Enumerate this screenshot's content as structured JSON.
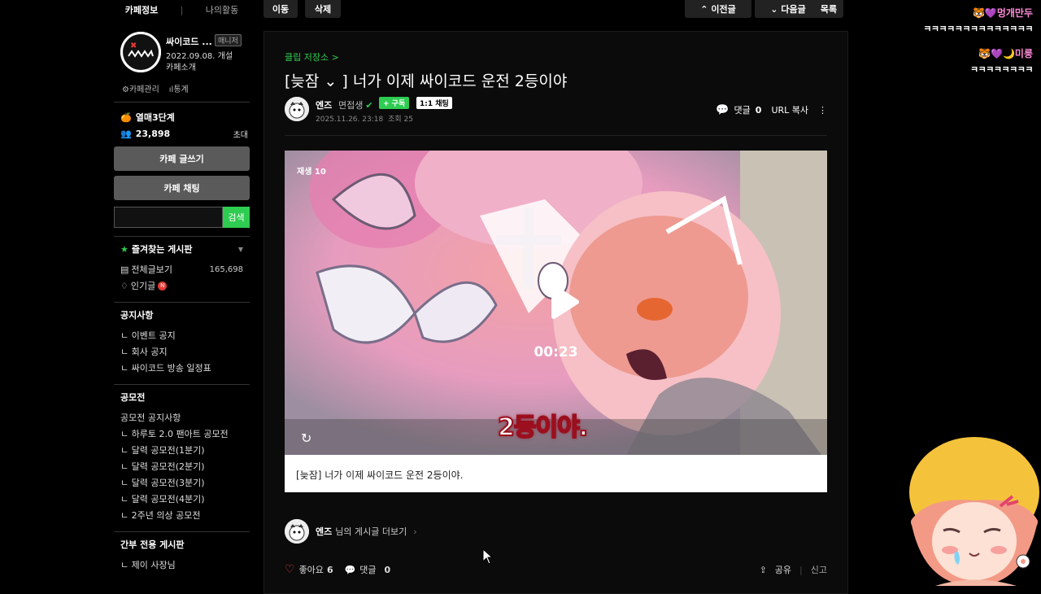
{
  "sidebar": {
    "tabs": [
      "카페정보",
      "나의활동"
    ],
    "cafe_name": "싸이코드 ...",
    "manager_badge": "매니저",
    "cafe_date": "2022.09.08. 개설",
    "cafe_intro": "카페소개",
    "cafe_manage": "카페관리",
    "cafe_stats": "통계",
    "level": "열매3단계",
    "members": "23,898",
    "invite": "초대",
    "write_button": "카페 글쓰기",
    "chat_button": "카페 채팅",
    "search_button": "검색",
    "favorites_title": "즐겨찾는 게시판",
    "all_posts": "전체글보기",
    "all_posts_count": "165,698",
    "popular": "인기글",
    "new_badge": "N",
    "notice_title": "공지사항",
    "notice_items": [
      "ㄴ 이벤트 공지",
      "ㄴ 회사 공지",
      "ㄴ 싸이코드 방송 일정표"
    ],
    "contest_title": "공모전",
    "contest_items": [
      "공모전 공지사항",
      "ㄴ 하루토 2.0 팬아트 공모전",
      "ㄴ 달력 공모전(1분기)",
      "ㄴ 달력 공모전(2분기)",
      "ㄴ 달력 공모전(3분기)",
      "ㄴ 달력 공모전(4분기)",
      "ㄴ 2주년 의상 공모전"
    ],
    "staff_title": "간부 전용 게시판",
    "staff_items": [
      "ㄴ 제이 사장님"
    ]
  },
  "topbar": {
    "move": "이동",
    "delete": "삭제",
    "prev": "이전글",
    "next": "다음글",
    "list": "목록"
  },
  "article": {
    "breadcrumb": "클립 저장소 >",
    "title_tag": "[늦잠 ⌄ ]",
    "title": "너가 이제 싸이코드 운전 2등이야",
    "author": "엔즈",
    "grade": "면접생",
    "subscribe": "+ 구독",
    "chat_1to1": "1:1 채팅",
    "date": "2025.11.26. 23:18",
    "views": "조회 25",
    "comments_label": "댓글",
    "comments_count": "0",
    "url_copy": "URL 복사",
    "video_plays": "재생 10",
    "video_duration": "00:23",
    "video_subtitle": "2등이야.",
    "caption": "[늦잠] 너가 이제 싸이코드 운전 2등이야.",
    "more_posts_author": "엔즈",
    "more_posts": "님의 게시글 더보기",
    "likes_label": "좋아요",
    "likes_count": "6",
    "share": "공유",
    "report": "신고"
  },
  "chat": [
    {
      "name": "멍개만두",
      "msg": "ㅋㅋㅋㅋㅋㅋㅋㅋㅋㅋㅋㅋㅋㅋ"
    },
    {
      "name": "미룽",
      "msg": "ㅋㅋㅋㅋㅋㅋㅋㅋ"
    }
  ],
  "colors": {
    "accent_green": "#2ecc50",
    "background": "#000000",
    "chat_name_pink": "#ff8ad8"
  }
}
